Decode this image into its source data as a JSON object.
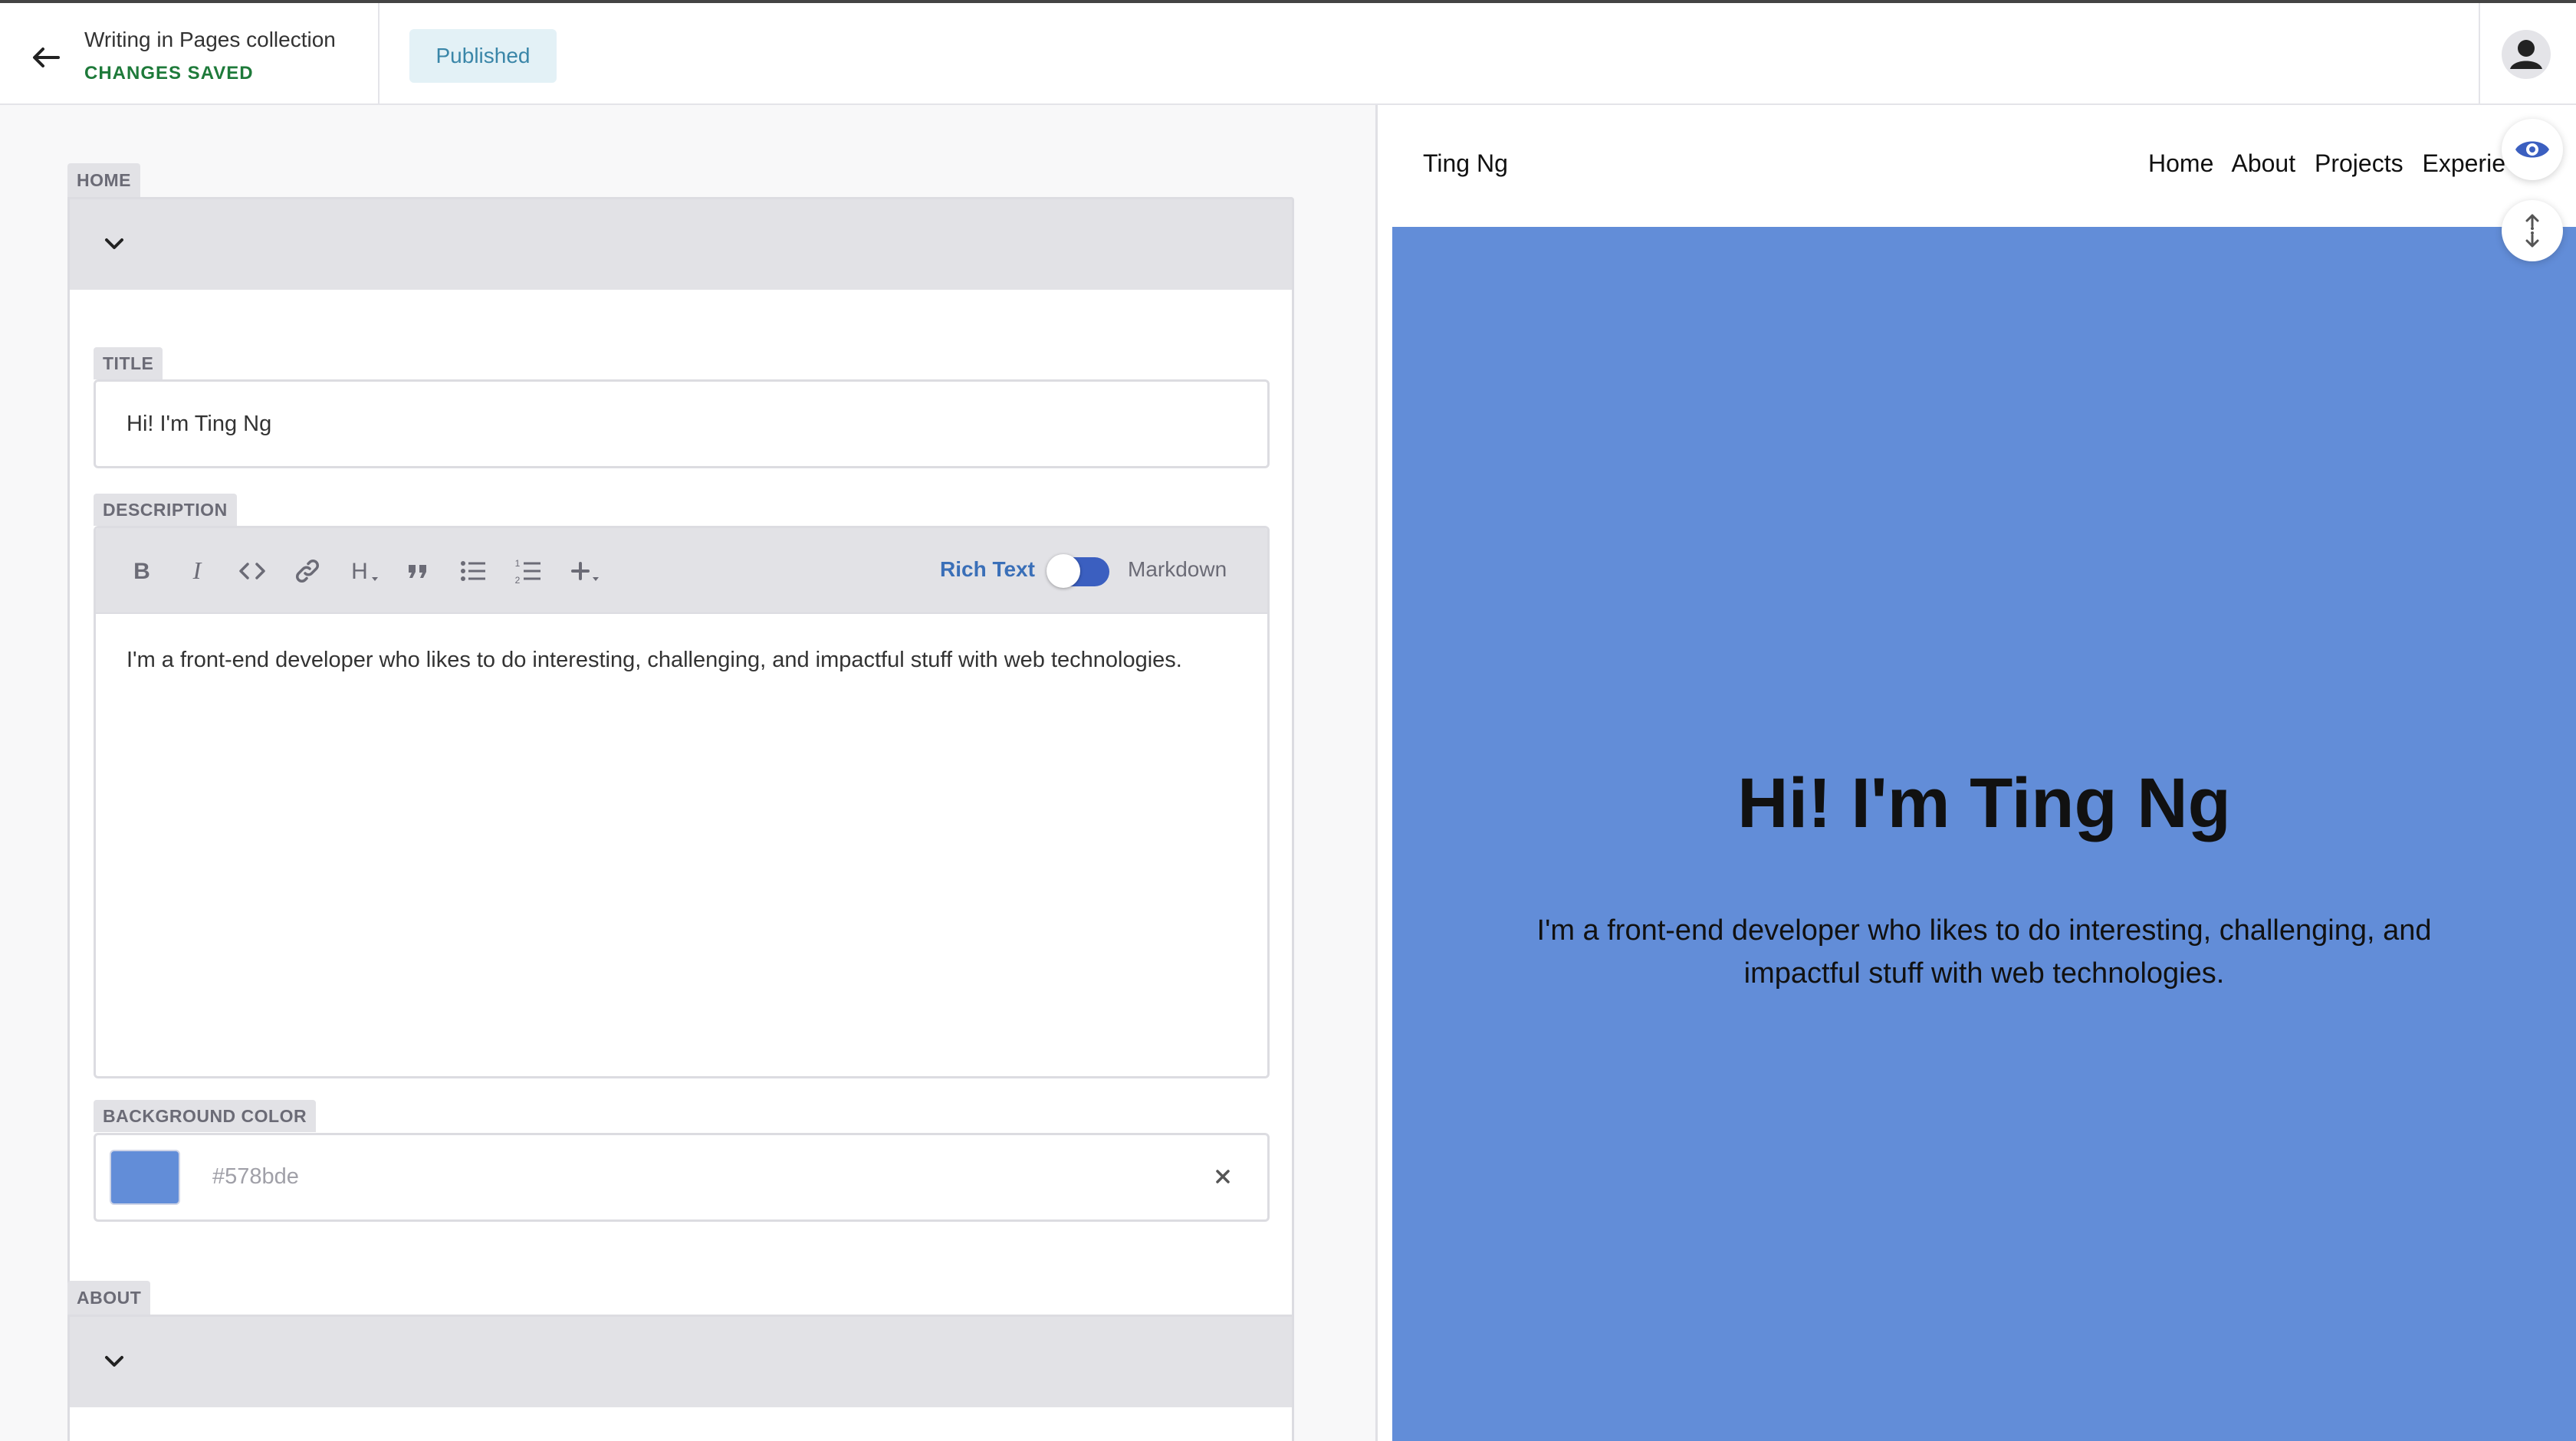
{
  "header": {
    "collection_text": "Writing in Pages collection",
    "save_status": "CHANGES SAVED",
    "publish_status": "Published"
  },
  "editor": {
    "home": {
      "label": "HOME",
      "fields": {
        "title": {
          "label": "TITLE",
          "value": "Hi! I'm Ting Ng"
        },
        "description": {
          "label": "DESCRIPTION",
          "toolbar_icons": [
            "bold-icon",
            "italic-icon",
            "code-icon",
            "link-icon",
            "heading-icon",
            "quote-icon",
            "bulleted-list-icon",
            "numbered-list-icon",
            "add-icon"
          ],
          "mode_rich": "Rich Text",
          "mode_markdown": "Markdown",
          "value": "I'm a front-end developer who likes to do interesting, challenging, and impactful stuff with web technologies."
        },
        "background_color": {
          "label": "BACKGROUND COLOR",
          "value": "#578bde"
        }
      }
    },
    "about": {
      "label": "ABOUT"
    }
  },
  "preview": {
    "site_name": "Ting Ng",
    "nav": [
      "Home",
      "About",
      "Projects",
      "Experience"
    ],
    "hero_title": "Hi! I'm Ting Ng",
    "hero_description": "I'm a front-end developer who likes to do interesting, challenging, and impactful stuff with web technologies.",
    "hero_bg": "#628dd8"
  },
  "colors": {
    "accent": "#3b5fc0",
    "saved_green": "#1e7a3a",
    "published_text": "#3a86a8"
  }
}
